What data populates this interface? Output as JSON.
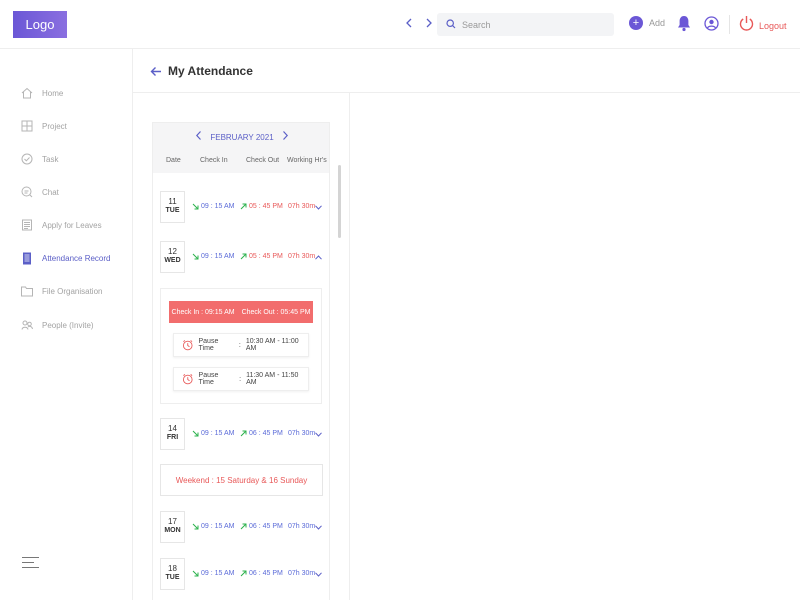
{
  "header": {
    "logo": "Logo",
    "search_placeholder": "Search",
    "add_label": "Add",
    "logout_label": "Logout",
    "prev_icon": "chevron-left-icon",
    "next_icon": "chevron-right-icon"
  },
  "sidebar": {
    "items": [
      {
        "label": "Home",
        "icon": "home-icon",
        "active": false
      },
      {
        "label": "Project",
        "icon": "grid-icon",
        "active": false
      },
      {
        "label": "Task",
        "icon": "check-circle-icon",
        "active": false
      },
      {
        "label": "Chat",
        "icon": "chat-icon",
        "active": false
      },
      {
        "label": "Apply for Leaves",
        "icon": "calendar-icon",
        "active": false
      },
      {
        "label": "Attendance Record",
        "icon": "document-icon",
        "active": true
      },
      {
        "label": "File Organisation",
        "icon": "folder-icon",
        "active": false
      },
      {
        "label": "People (Invite)",
        "icon": "people-icon",
        "active": false
      }
    ]
  },
  "page": {
    "title": "My Attendance"
  },
  "attendance": {
    "month": "FEBRUARY 2021",
    "columns": [
      "Date",
      "Check In",
      "Check Out",
      "Working Hr's"
    ],
    "rows": [
      {
        "date": "11",
        "day": "TUE",
        "check_in": "09 : 15 AM",
        "check_out": "05 : 45 PM",
        "hours": "07h 30m"
      },
      {
        "date": "12",
        "day": "WED",
        "check_in": "09 : 15 AM",
        "check_out": "05 : 45 PM",
        "hours": "07h 30m"
      },
      {
        "date": "14",
        "day": "FRI",
        "check_in": "09 : 15 AM",
        "check_out": "06 : 45 PM",
        "hours": "07h 30m"
      },
      {
        "date": "17",
        "day": "MON",
        "check_in": "09 : 15 AM",
        "check_out": "06 : 45 PM",
        "hours": "07h 30m"
      },
      {
        "date": "18",
        "day": "TUE",
        "check_in": "09 : 15 AM",
        "check_out": "06 : 45 PM",
        "hours": "07h 30m"
      }
    ],
    "detail": {
      "check_in": "Check In : 09:15 AM",
      "check_out": "Check Out : 05:45 PM",
      "pauses": [
        {
          "label": "Pause Time",
          "range": "10:30 AM - 11:00 AM"
        },
        {
          "label": "Pause Time",
          "range": "11:30 AM - 11:50 AM"
        }
      ]
    },
    "weekend_note": "Weekend : 15 Saturday & 16 Sunday"
  },
  "colors": {
    "accent": "#5b5fc7",
    "logo_gradient_start": "#6b57d6",
    "danger": "#e85858",
    "banner": "#f26d6d",
    "success": "#2bb24c"
  }
}
